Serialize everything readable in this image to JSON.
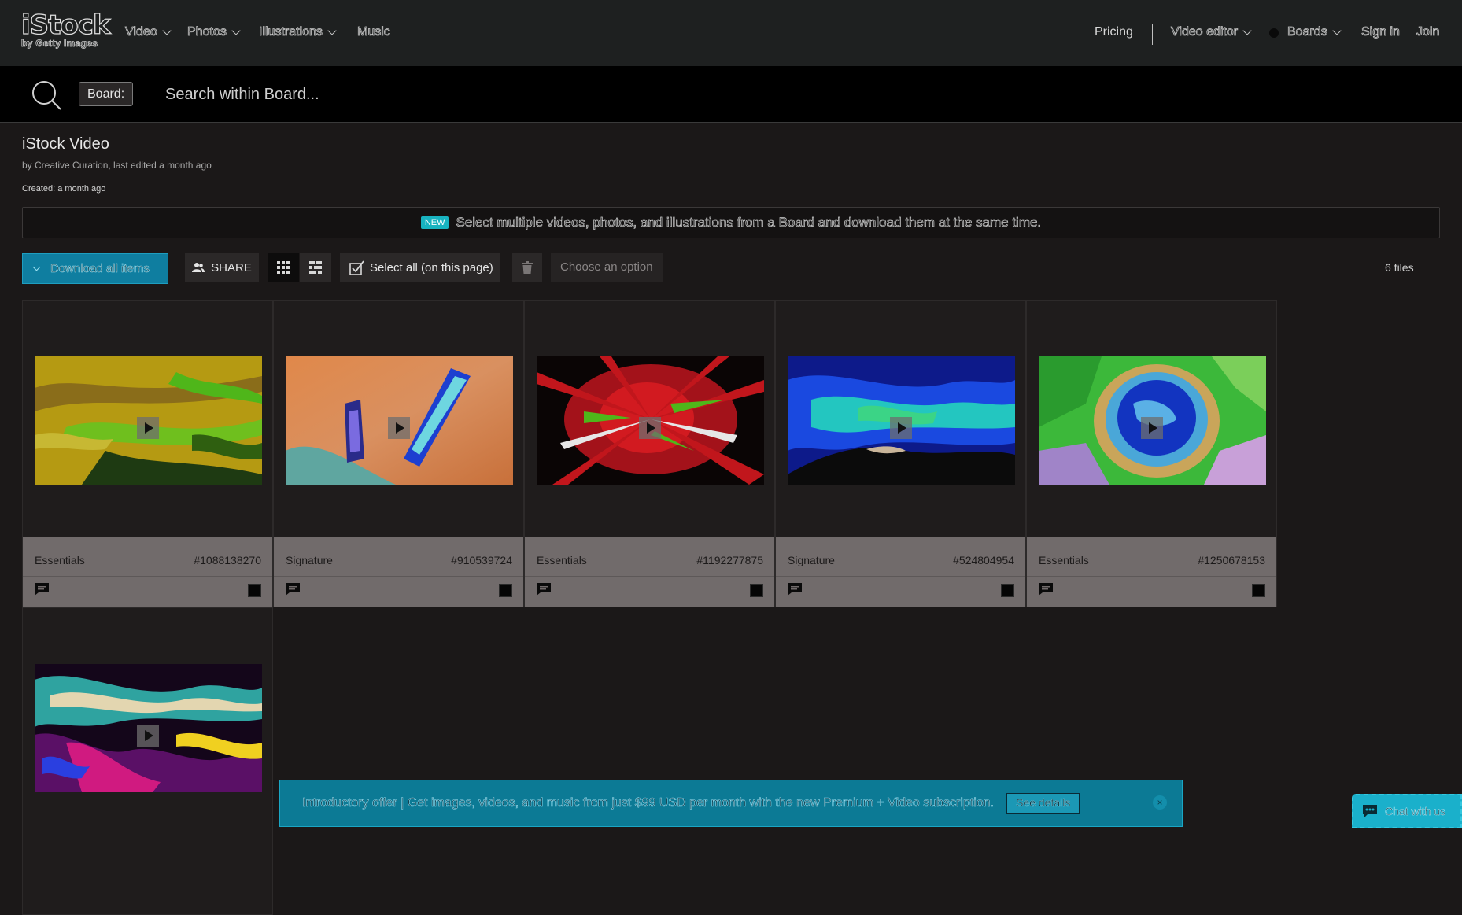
{
  "nav": {
    "logo_main": "iStock",
    "logo_sub": "by Getty Images",
    "left_items": [
      "Video",
      "Photos",
      "Illustrations",
      "Music"
    ],
    "pricing": "Pricing",
    "video_editor": "Video editor",
    "boards": "Boards",
    "sign_in": "Sign in",
    "join": "Join"
  },
  "search": {
    "scope_pill": "Board:",
    "placeholder": "Search within Board..."
  },
  "board": {
    "title": "iStock Video",
    "byline": "by Creative Curation, last edited a month ago",
    "created": "Created: a month ago"
  },
  "notice": {
    "badge": "NEW",
    "text": "Select multiple videos, photos, and illustrations from a Board and download them at the same time."
  },
  "toolbar": {
    "download_all": "Download all items",
    "share": "SHARE",
    "select_all": "Select all (on this page)",
    "choose_option": "Choose an option",
    "files_count": "6 files"
  },
  "items": [
    {
      "tier": "Essentials",
      "id": "#1088138270"
    },
    {
      "tier": "Signature",
      "id": "#910539724"
    },
    {
      "tier": "Essentials",
      "id": "#1192277875"
    },
    {
      "tier": "Signature",
      "id": "#524804954"
    },
    {
      "tier": "Essentials",
      "id": "#1250678153"
    },
    {
      "tier": "",
      "id": ""
    }
  ],
  "promo": {
    "text": "Introductory offer | Get images, videos, and music from just $99 USD per month with the new Premium + Video subscription.",
    "button": "See details",
    "close": "×"
  },
  "chat": {
    "label": "Chat with us"
  },
  "colors": {
    "accent": "#0f7ea0",
    "promo_bg": "#0c7a95",
    "chat_bg": "#1ab0cb",
    "new_badge": "#18b3c0"
  }
}
